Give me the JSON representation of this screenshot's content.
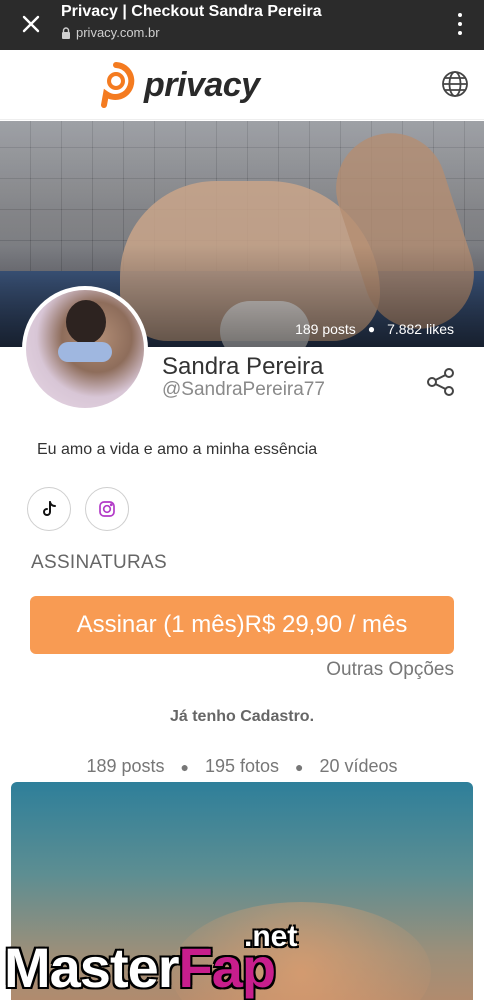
{
  "browser": {
    "title": "Privacy | Checkout Sandra Pereira",
    "url": "privacy.com.br"
  },
  "site": {
    "logo_text": "privacy",
    "brand_color": "#f47b20"
  },
  "profile": {
    "posts_stat": "189 posts",
    "likes_stat": "7.882 likes",
    "name": "Sandra Pereira",
    "handle": "@SandraPereira77",
    "bio": "Eu amo a vida e amo a minha essência",
    "socials": [
      "tiktok-icon",
      "instagram-icon"
    ]
  },
  "subscriptions": {
    "section_title": "ASSINATURAS",
    "button_label": "Assinar (1 mês)R$ 29,90 / mês",
    "button_color": "#f89b53",
    "other_options": "Outras Opções",
    "login_link": "Já tenho Cadastro."
  },
  "counts": {
    "posts": "189 posts",
    "photos": "195 fotos",
    "videos": "20 vídeos"
  },
  "watermark": {
    "part1": "Master",
    "part2": "Fap",
    "part3": ".net"
  }
}
